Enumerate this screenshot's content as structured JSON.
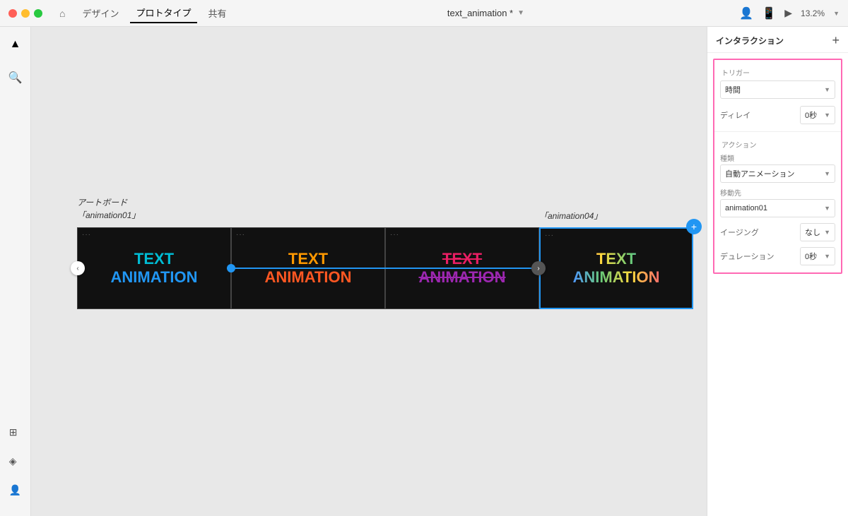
{
  "titlebar": {
    "nav_items": [
      "デザイン",
      "プロトタイプ",
      "共有"
    ],
    "active_nav": "プロトタイプ",
    "file_title": "text_animation *",
    "zoom": "13.2%"
  },
  "canvas": {
    "artboard_label_left_line1": "アートボード",
    "artboard_label_left_line2": "「animation01」",
    "artboard_label_right": "「animation04」",
    "frames": [
      {
        "id": 1,
        "text_line1": "TEXT",
        "text_line2": "ANIMATION",
        "colorClass": "frame1-text"
      },
      {
        "id": 2,
        "text_line1": "TEXT",
        "text_line2": "ANIMATION",
        "colorClass": "frame2-text"
      },
      {
        "id": 3,
        "text_line1": "TEXT",
        "text_line2": "ANIMATION",
        "colorClass": "frame3-text"
      },
      {
        "id": 4,
        "text_line1": "TEXT",
        "text_line2": "ANIMATION",
        "colorClass": "frame4-text"
      }
    ]
  },
  "right_panel": {
    "title": "インタラクション",
    "add_btn_label": "+",
    "sections": {
      "trigger": {
        "label": "トリガー",
        "trigger_value": "時間",
        "delay_label": "ディレイ",
        "delay_value": "0秒"
      },
      "action": {
        "label": "アクション",
        "kind_label": "種類",
        "kind_value": "自動アニメーション",
        "dest_label": "移動先",
        "dest_value": "animation01",
        "easing_label": "イージング",
        "easing_value": "なし",
        "duration_label": "デュレーション",
        "duration_value": "0秒"
      }
    }
  },
  "toolbar": {
    "tools": [
      "▲",
      "🔍"
    ],
    "bottom_tools": [
      "□",
      "◈",
      "👤"
    ]
  }
}
